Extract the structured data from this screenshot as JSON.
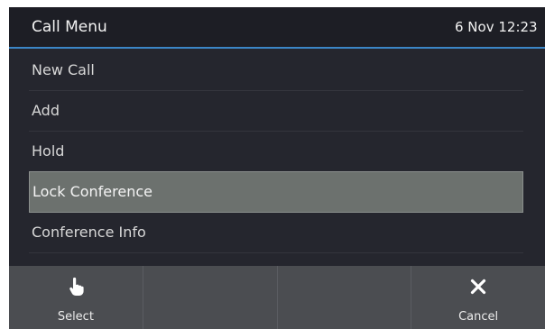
{
  "header": {
    "title": "Call Menu",
    "clock": "6 Nov 12:23"
  },
  "menu": {
    "items": [
      {
        "label": "New Call"
      },
      {
        "label": "Add"
      },
      {
        "label": "Hold"
      },
      {
        "label": "Lock Conference",
        "selected": true
      },
      {
        "label": "Conference Info"
      }
    ]
  },
  "softkeys": [
    {
      "label": "Select",
      "icon": "hand-pointer-icon"
    },
    {
      "label": "",
      "icon": ""
    },
    {
      "label": "",
      "icon": ""
    },
    {
      "label": "Cancel",
      "icon": "close-icon"
    }
  ],
  "colors": {
    "header_underline": "#3b86c7",
    "selection": "#6c716e",
    "background": "#25262e",
    "softkey_bar": "#4b4d51"
  }
}
